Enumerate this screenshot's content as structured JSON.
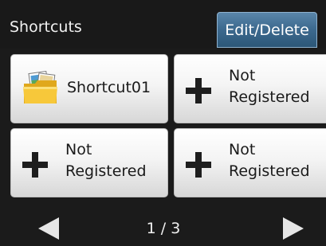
{
  "header": {
    "title": "Shortcuts",
    "edit_label": "Edit/Delete"
  },
  "tiles": [
    {
      "label": "Shortcut01",
      "icon": "folder-icon"
    },
    {
      "line1": "Not",
      "line2": "Registered",
      "icon": "plus-icon"
    },
    {
      "line1": "Not",
      "line2": "Registered",
      "icon": "plus-icon"
    },
    {
      "line1": "Not",
      "line2": "Registered",
      "icon": "plus-icon"
    }
  ],
  "footer": {
    "page_indicator": "1 / 3",
    "prev_icon": "left-arrow-icon",
    "next_icon": "right-arrow-icon"
  },
  "colors": {
    "background": "#1b1b1b",
    "edit_button": "#3e6b90",
    "tile": "#f4f4f4",
    "text_light": "#f2f2f2",
    "text_dark": "#1a1a1a"
  }
}
